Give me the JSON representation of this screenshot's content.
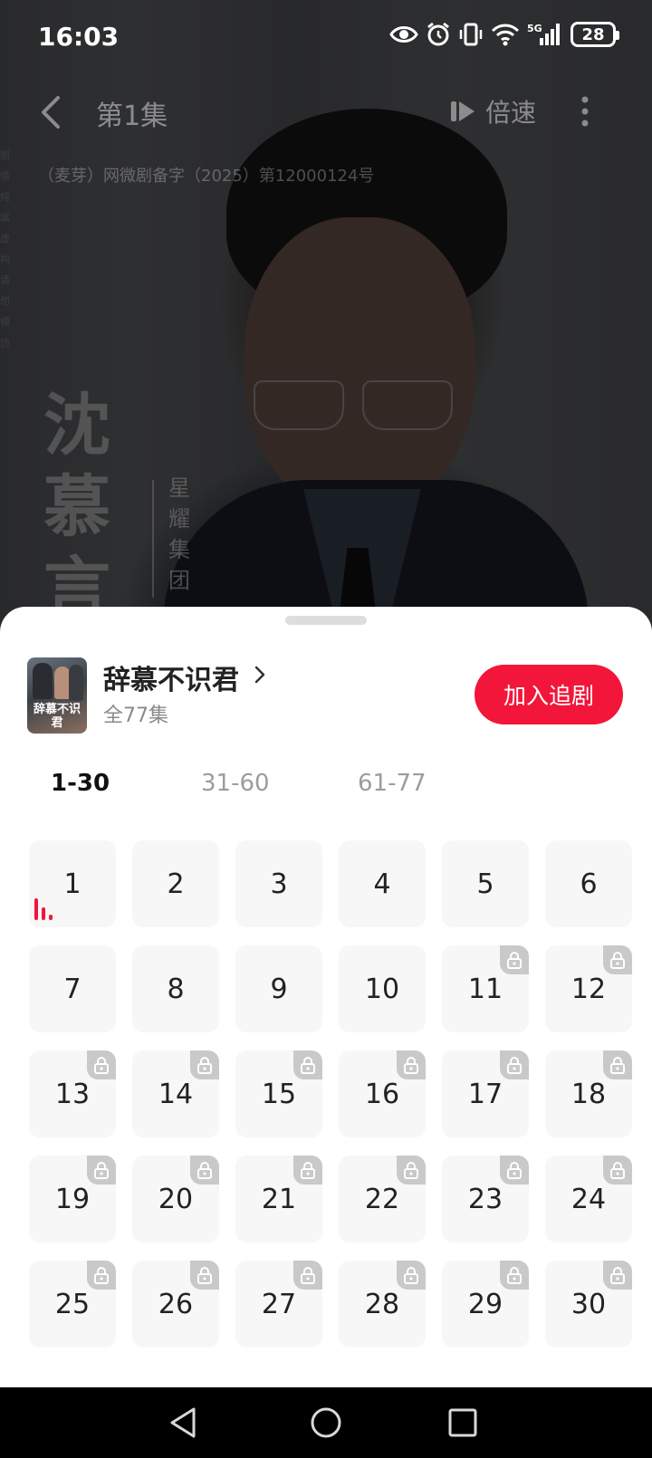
{
  "status_bar": {
    "time": "16:03",
    "network": "5G",
    "battery": "28"
  },
  "player": {
    "episode_title": "第1集",
    "speed_label": "倍速",
    "license_text": "（麦芽）网微剧备字（2025）第12000124号",
    "side_text": "剧情纯属虚构请勿模仿",
    "character_name": "沈慕言",
    "character_company": "星耀集团"
  },
  "sheet": {
    "drama_title": "辞慕不识君",
    "poster_title": "辞慕不识君",
    "episode_count": "全77集",
    "follow_button": "加入追剧",
    "tabs": [
      "1-30",
      "31-60",
      "61-77"
    ],
    "active_tab": "1-30",
    "episodes": [
      {
        "num": "1",
        "locked": false,
        "playing": true
      },
      {
        "num": "2",
        "locked": false
      },
      {
        "num": "3",
        "locked": false
      },
      {
        "num": "4",
        "locked": false
      },
      {
        "num": "5",
        "locked": false
      },
      {
        "num": "6",
        "locked": false
      },
      {
        "num": "7",
        "locked": false
      },
      {
        "num": "8",
        "locked": false
      },
      {
        "num": "9",
        "locked": false
      },
      {
        "num": "10",
        "locked": false
      },
      {
        "num": "11",
        "locked": true
      },
      {
        "num": "12",
        "locked": true
      },
      {
        "num": "13",
        "locked": true
      },
      {
        "num": "14",
        "locked": true
      },
      {
        "num": "15",
        "locked": true
      },
      {
        "num": "16",
        "locked": true
      },
      {
        "num": "17",
        "locked": true
      },
      {
        "num": "18",
        "locked": true
      },
      {
        "num": "19",
        "locked": true
      },
      {
        "num": "20",
        "locked": true
      },
      {
        "num": "21",
        "locked": true
      },
      {
        "num": "22",
        "locked": true
      },
      {
        "num": "23",
        "locked": true
      },
      {
        "num": "24",
        "locked": true
      },
      {
        "num": "25",
        "locked": true
      },
      {
        "num": "26",
        "locked": true
      },
      {
        "num": "27",
        "locked": true
      },
      {
        "num": "28",
        "locked": true
      },
      {
        "num": "29",
        "locked": true
      },
      {
        "num": "30",
        "locked": true
      }
    ]
  },
  "colors": {
    "accent": "#f2163a",
    "lock_badge": "#c9c9c9",
    "cell_bg": "#f7f7f7"
  },
  "icons": {
    "back": "chevron-left-icon",
    "speed": "speed-icon",
    "more": "more-vertical-icon",
    "lock": "lock-icon",
    "playing": "playing-bars-icon",
    "nav_back": "triangle-back-icon",
    "nav_home": "circle-home-icon",
    "nav_recent": "square-recents-icon"
  }
}
